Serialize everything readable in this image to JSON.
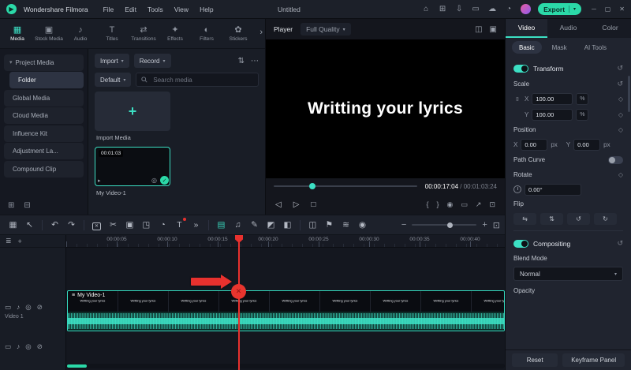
{
  "colors": {
    "accent": "#3ce0c4",
    "export_green": "#2bd9a8",
    "annotation_red": "#e8312e"
  },
  "titlebar": {
    "app_name": "Wondershare Filmora",
    "menus": [
      "File",
      "Edit",
      "Tools",
      "View",
      "Help"
    ],
    "project_title": "Untitled",
    "quick_icons": [
      {
        "name": "home-icon",
        "glyph": "⌂"
      },
      {
        "name": "apps-icon",
        "glyph": "⊞"
      },
      {
        "name": "save-icon",
        "glyph": "⇩"
      },
      {
        "name": "display-icon",
        "glyph": "▭"
      },
      {
        "name": "cloud-icon",
        "glyph": "☁"
      },
      {
        "name": "notification-icon",
        "glyph": "◔"
      }
    ],
    "export": {
      "label": "Export",
      "caret": "▾"
    },
    "window_controls": [
      {
        "name": "minimize-button",
        "glyph": "─"
      },
      {
        "name": "maximize-button",
        "glyph": "▢"
      },
      {
        "name": "close-button",
        "glyph": "✕"
      }
    ]
  },
  "media_tabs": {
    "overflow_glyph": "›",
    "items": [
      {
        "name": "tab-media",
        "label": "Media",
        "glyph": "▦",
        "cls": "active"
      },
      {
        "name": "tab-stock-media",
        "label": "Stock Media",
        "glyph": "▣"
      },
      {
        "name": "tab-audio",
        "label": "Audio",
        "glyph": "♪"
      },
      {
        "name": "tab-titles",
        "label": "Titles",
        "glyph": "T"
      },
      {
        "name": "tab-transitions",
        "label": "Transitions",
        "glyph": "⇄"
      },
      {
        "name": "tab-effects",
        "label": "Effects",
        "glyph": "✦"
      },
      {
        "name": "tab-filters",
        "label": "Filters",
        "glyph": "◐"
      },
      {
        "name": "tab-stickers",
        "label": "Stickers",
        "glyph": "✿"
      }
    ]
  },
  "sidebar": {
    "items": [
      {
        "name": "sidebar-item-project-media",
        "label": "Project Media",
        "caret": "▾"
      },
      {
        "name": "sidebar-item-folder",
        "label": "Folder",
        "cls": "active indent"
      },
      {
        "name": "sidebar-item-global-media",
        "label": "Global Media"
      },
      {
        "name": "sidebar-item-cloud-media",
        "label": "Cloud Media"
      },
      {
        "name": "sidebar-item-influence-kit",
        "label": "Influence Kit"
      },
      {
        "name": "sidebar-item-adjustment-layer",
        "label": "Adjustment La..."
      },
      {
        "name": "sidebar-item-compound-clip",
        "label": "Compound Clip"
      }
    ],
    "footer_icons": [
      {
        "name": "add-folder-icon",
        "glyph": "⊞"
      },
      {
        "name": "delete-folder-icon",
        "glyph": "⊟"
      }
    ]
  },
  "media_panel": {
    "import_button": {
      "label": "Import",
      "caret": "▾"
    },
    "record_button": {
      "label": "Record",
      "caret": "▾"
    },
    "sort_icon": "⇅",
    "more_icon": "⋯",
    "default_dropdown": {
      "label": "Default",
      "caret": "▾"
    },
    "search": {
      "placeholder": "Search media"
    },
    "import_tile": {
      "plus": "+",
      "caption": "Import Media"
    },
    "video_tile": {
      "caption": "My Video-1",
      "duration": "00:01:03",
      "check": "✓",
      "type_glyph": "▸",
      "eye_glyph": "◎"
    }
  },
  "player": {
    "label": "Player",
    "quality_dropdown": {
      "label": "Full Quality",
      "caret": "▾"
    },
    "header_icons": [
      {
        "name": "view-mode-icon",
        "glyph": "◫"
      },
      {
        "name": "preview-quality-icon",
        "glyph": "▣"
      }
    ],
    "preview_text": "Writting your lyrics",
    "current_time": "00:00:17:04",
    "separator": "/",
    "total_time": "00:01:03:24",
    "transport_left": [
      {
        "name": "previous-frame-icon",
        "glyph": "◁"
      },
      {
        "name": "play-icon",
        "glyph": "▷"
      },
      {
        "name": "stop-icon",
        "glyph": "□"
      }
    ],
    "transport_right": [
      {
        "name": "mark-in-icon",
        "glyph": "{"
      },
      {
        "name": "mark-out-icon",
        "glyph": "}"
      },
      {
        "name": "snapshot-icon",
        "glyph": "◉"
      },
      {
        "name": "aspect-ratio-icon",
        "glyph": "▭"
      },
      {
        "name": "expand-icon",
        "glyph": "↗"
      },
      {
        "name": "fullscreen-icon",
        "glyph": "⊡"
      }
    ]
  },
  "toolbar": {
    "group_view": [
      {
        "name": "screen-layout-icon",
        "glyph": "▦"
      },
      {
        "name": "pointer-tool-icon",
        "glyph": "↖"
      }
    ],
    "group_history": [
      {
        "name": "undo-icon",
        "glyph": "↶"
      },
      {
        "name": "redo-icon",
        "glyph": "↷"
      }
    ],
    "group_edit": [
      {
        "name": "delete-icon",
        "glyph": "✕",
        "cls": "boxed"
      },
      {
        "name": "split-scissors-icon",
        "glyph": "✂"
      },
      {
        "name": "duplicate-icon",
        "glyph": "▣"
      },
      {
        "name": "crop-icon",
        "glyph": "◳"
      },
      {
        "name": "speed-icon",
        "glyph": "◔"
      },
      {
        "name": "quick-text-icon",
        "glyph": "T",
        "cls": "has-dot"
      },
      {
        "name": "more-tools-icon",
        "glyph": "»"
      }
    ],
    "group_media": [
      {
        "name": "add-to-timeline-icon",
        "glyph": "▤",
        "cls": "teal"
      },
      {
        "name": "record-voiceover-icon",
        "glyph": "♫"
      },
      {
        "name": "edit-pen-icon",
        "glyph": "✎"
      },
      {
        "name": "mask-icon",
        "glyph": "◩"
      },
      {
        "name": "chroma-key-icon",
        "glyph": "◧"
      }
    ],
    "group_right": [
      {
        "name": "split-clip-icon",
        "glyph": "◫"
      },
      {
        "name": "marker-icon",
        "glyph": "⚑"
      },
      {
        "name": "render-preview-icon",
        "glyph": "≋"
      },
      {
        "name": "snapshot-tool-icon",
        "glyph": "◉"
      }
    ],
    "zoom": {
      "out_glyph": "−",
      "in_glyph": "+",
      "fit_glyph": "⊡"
    }
  },
  "timeline": {
    "header_icons": [
      {
        "name": "manage-tracks-icon",
        "glyph": "≣"
      },
      {
        "name": "add-track-icon",
        "glyph": "+"
      }
    ],
    "ruler_labels": [
      "00:00:05",
      "00:00:10",
      "00:00:15",
      "00:00:20",
      "00:00:25",
      "00:00:30",
      "00:00:35",
      "00:00:40"
    ],
    "track1": {
      "label": "Video 1",
      "icons": [
        {
          "name": "track-type-icon",
          "glyph": "▭"
        },
        {
          "name": "mute-track-icon",
          "glyph": "♪"
        },
        {
          "name": "hide-track-icon",
          "glyph": "◎"
        },
        {
          "name": "lock-track-icon",
          "glyph": "⊘"
        }
      ]
    },
    "track2": {
      "icons": [
        {
          "name": "track-type-icon",
          "glyph": "▭"
        },
        {
          "name": "mute-track-icon",
          "glyph": "♪"
        },
        {
          "name": "hide-track-icon",
          "glyph": "◎"
        },
        {
          "name": "lock-track-icon",
          "glyph": "⊘"
        }
      ]
    },
    "clip": {
      "name": "My Video-1",
      "menu_glyph": "≡",
      "text_segments": [
        "Writting your lyrics",
        "Writting your lyrics",
        "Writting your lyrics",
        "Writting your lyrics",
        "Writting your lyrics",
        "Writting your lyrics",
        "Writting your lyrics",
        "Writting your lyrics",
        "Writting your lyrics"
      ]
    }
  },
  "properties": {
    "tabs": [
      {
        "name": "props-tab-video",
        "label": "Video",
        "cls": "active"
      },
      {
        "name": "props-tab-audio",
        "label": "Audio"
      },
      {
        "name": "props-tab-color",
        "label": "Color"
      }
    ],
    "subtabs": [
      {
        "name": "subtab-basic",
        "label": "Basic",
        "cls": "active"
      },
      {
        "name": "subtab-mask",
        "label": "Mask"
      },
      {
        "name": "subtab-ai-tools",
        "label": "AI Tools"
      }
    ],
    "transform": {
      "label": "Transform",
      "reset_glyph": "↺"
    },
    "scale": {
      "label": "Scale",
      "reset_glyph": "↺",
      "link_glyph": "∞",
      "x_label": "X",
      "x_value": "100.00",
      "x_unit": "%",
      "y_label": "Y",
      "y_value": "100.00",
      "y_unit": "%",
      "kf_glyph": "◇"
    },
    "position": {
      "label": "Position",
      "kf_glyph": "◇",
      "x_label": "X",
      "x_value": "0.00",
      "x_unit": "px",
      "y_label": "Y",
      "y_value": "0.00",
      "y_unit": "px"
    },
    "path_curve": {
      "label": "Path Curve"
    },
    "rotate": {
      "label": "Rotate",
      "kf_glyph": "◇",
      "value": "0.00°"
    },
    "flip": {
      "label": "Flip",
      "buttons": [
        {
          "name": "flip-horizontal-button",
          "glyph": "⇆"
        },
        {
          "name": "flip-vertical-button",
          "glyph": "⇅"
        },
        {
          "name": "rotate-ccw-button",
          "glyph": "↺"
        },
        {
          "name": "rotate-cw-button",
          "glyph": "↻"
        }
      ]
    },
    "compositing": {
      "label": "Compositing",
      "reset_glyph": "↺"
    },
    "blend_mode": {
      "label": "Blend Mode",
      "value": "Normal",
      "caret": "▾"
    },
    "opacity": {
      "label": "Opacity"
    },
    "footer": {
      "reset_label": "Reset",
      "keyframe_label": "Keyframe Panel"
    }
  }
}
